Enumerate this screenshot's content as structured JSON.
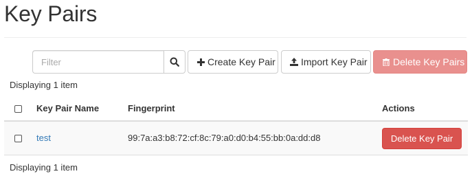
{
  "page": {
    "title": "Key Pairs"
  },
  "toolbar": {
    "filter_placeholder": "Filter",
    "create_label": "Create Key Pair",
    "import_label": "Import Key Pair",
    "delete_all_label": "Delete Key Pairs"
  },
  "table": {
    "count_top": "Displaying 1 item",
    "count_bottom": "Displaying 1 item",
    "headers": {
      "name": "Key Pair Name",
      "fingerprint": "Fingerprint",
      "actions": "Actions"
    },
    "rows": [
      {
        "name": "test",
        "fingerprint": "99:7a:a3:b8:72:cf:8c:79:a0:d0:b4:55:bb:0a:dd:d8",
        "action_label": "Delete Key Pair"
      }
    ]
  },
  "colors": {
    "link": "#337ab7",
    "danger": "#d9534f",
    "danger_disabled": "#e9908e"
  },
  "icons": {
    "filter": "search-icon",
    "create": "plus-icon",
    "import": "upload-icon",
    "delete_all": "trash-icon"
  }
}
